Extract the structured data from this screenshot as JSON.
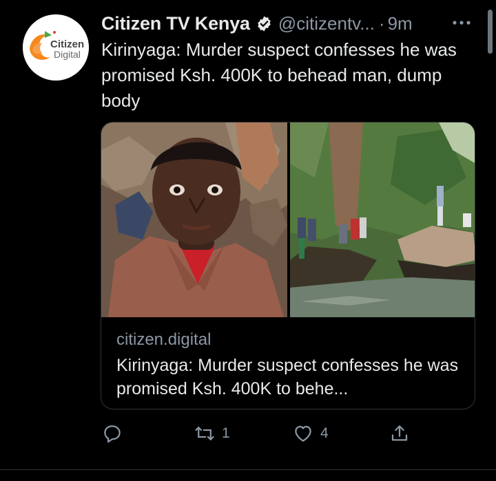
{
  "tweet": {
    "display_name": "Citizen TV Kenya",
    "handle": "@citizentv...",
    "separator": "·",
    "time": "9m",
    "text": "Kirinyaga: Murder suspect confesses he was promised Ksh. 400K to behead man, dump body",
    "avatar": {
      "label_top": "Citizen",
      "label_bottom": "Digital",
      "brand_colors": [
        "#f6891f",
        "#4aa84a",
        "#e63a2e"
      ]
    },
    "card": {
      "domain": "citizen.digital",
      "title": "Kirinyaga: Murder suspect confesses he was promised Ksh. 400K to behe..."
    },
    "actions": {
      "reply_count": "",
      "retweet_count": "1",
      "like_count": "4"
    }
  },
  "colors": {
    "background": "#000000",
    "text_primary": "#e7e9ea",
    "text_secondary": "#8b98a5",
    "border": "#2f3336"
  }
}
